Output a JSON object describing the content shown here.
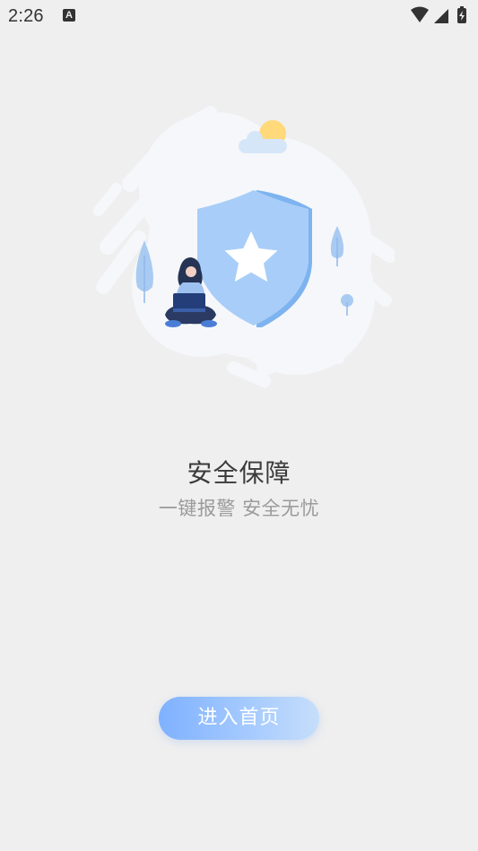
{
  "status_bar": {
    "time": "2:26",
    "notification_icon_letter": "A"
  },
  "illustration": {
    "shield_icon": "star-shield",
    "accent_color": "#a8cdf8"
  },
  "main": {
    "title": "安全保障",
    "subtitle": "一键报警 安全无忧"
  },
  "actions": {
    "enter_label": "进入首页"
  }
}
